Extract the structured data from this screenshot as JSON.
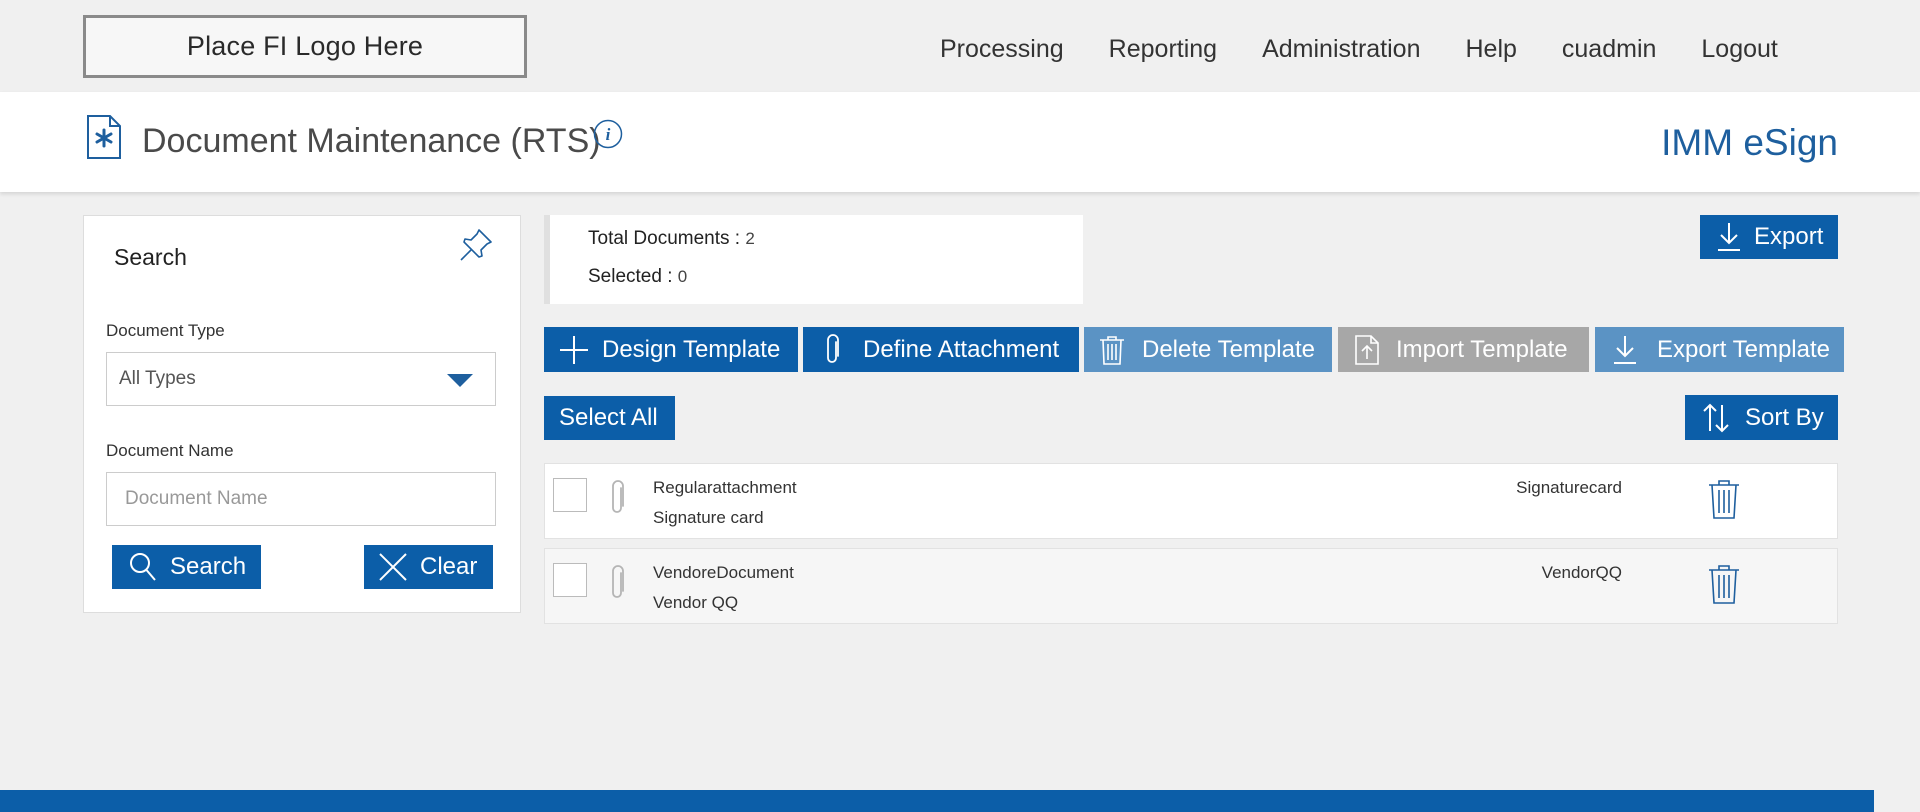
{
  "header": {
    "logo_text": "Place FI Logo Here",
    "nav": [
      "Processing",
      "Reporting",
      "Administration",
      "Help",
      "cuadmin",
      "Logout"
    ]
  },
  "title_bar": {
    "page_title": "Document Maintenance (RTS)",
    "app_name": "IMM eSign",
    "icons": [
      "document-settings-icon",
      "info-icon"
    ]
  },
  "search_panel": {
    "title": "Search",
    "doc_type_label": "Document Type",
    "doc_type_value": "All Types",
    "doc_name_label": "Document Name",
    "doc_name_placeholder": "Document Name",
    "search_label": "Search",
    "clear_label": "Clear"
  },
  "summary": {
    "total_label": "Total Documents :",
    "total_value": "2",
    "selected_label": "Selected :",
    "selected_value": "0"
  },
  "toolbar": {
    "export_label": "Export",
    "design_label": "Design Template",
    "define_label": "Define Attachment",
    "delete_label": "Delete Template",
    "import_label": "Import Template",
    "export_template_label": "Export Template",
    "select_all_label": "Select All",
    "sort_label": "Sort By"
  },
  "documents": [
    {
      "name": "Regularattachment",
      "description": "Signature card",
      "code": "Signaturecard"
    },
    {
      "name": "VendoreDocument",
      "description": "Vendor QQ",
      "code": "VendorQQ"
    }
  ],
  "colors": {
    "primary": "#0c5ea8",
    "primary_light": "#5b93c4",
    "disabled": "#a7a7a7",
    "brand_text": "#1e5f9e",
    "background": "#f0f0f0"
  }
}
